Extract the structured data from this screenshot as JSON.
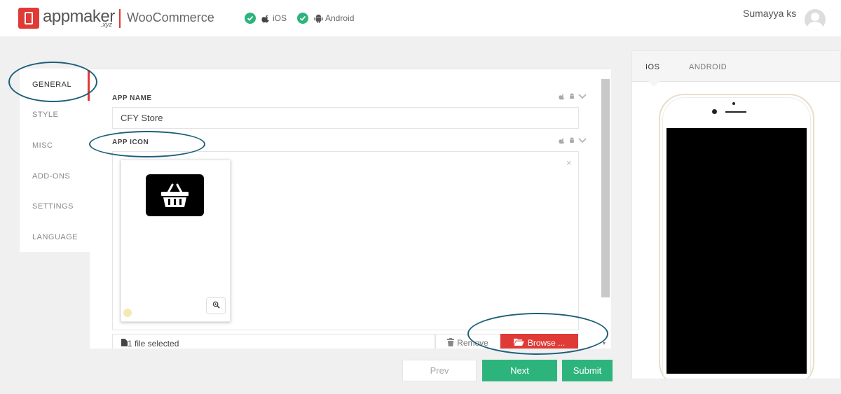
{
  "header": {
    "logo_text": "appmaker",
    "logo_sub": ".xyz",
    "brand": "WooCommerce",
    "platforms": [
      {
        "label": "iOS",
        "icon": "apple-icon",
        "checked": true
      },
      {
        "label": "Android",
        "icon": "android-icon",
        "checked": true
      }
    ],
    "user_name": "Sumayya ks"
  },
  "sidebar": {
    "items": [
      {
        "label": "GENERAL",
        "active": true
      },
      {
        "label": "STYLE",
        "active": false
      },
      {
        "label": "MISC",
        "active": false
      },
      {
        "label": "ADD-ONS",
        "active": false
      },
      {
        "label": "SETTINGS",
        "active": false
      },
      {
        "label": "LANGUAGE",
        "active": false
      }
    ]
  },
  "form": {
    "app_name": {
      "label": "APP NAME",
      "value": "CFY Store"
    },
    "app_icon": {
      "label": "APP ICON"
    },
    "upload": {
      "status": "1 file selected",
      "remove_label": "Remove",
      "browse_label": "Browse ...",
      "close": "×"
    }
  },
  "actions": {
    "prev": "Prev",
    "next": "Next",
    "submit": "Submit"
  },
  "preview": {
    "tabs": [
      {
        "label": "IOS",
        "active": true
      },
      {
        "label": "ANDROID",
        "active": false
      }
    ]
  },
  "colors": {
    "brand_red": "#e03a36",
    "accent_green": "#2db47d",
    "annotation_blue": "#1d5f7a"
  }
}
